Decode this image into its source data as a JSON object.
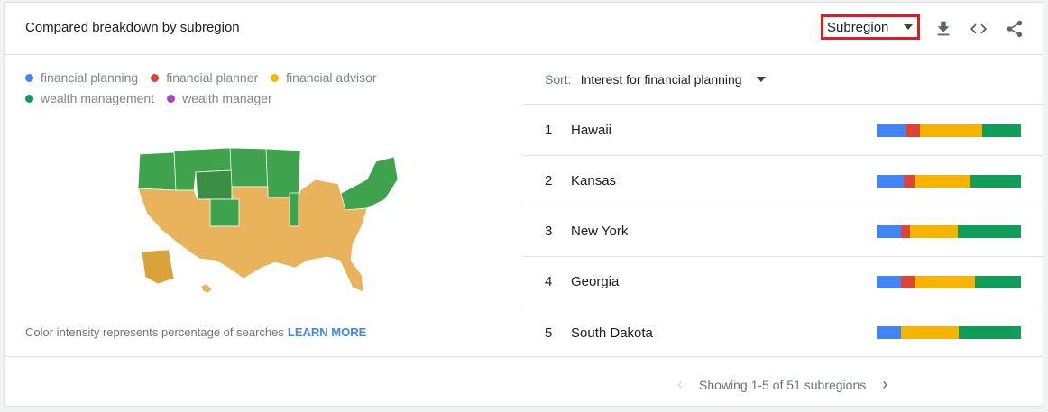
{
  "header": {
    "title": "Compared breakdown by subregion",
    "dropdown_value": "Subregion",
    "icons": [
      "download-icon",
      "embed-code-icon",
      "share-icon"
    ]
  },
  "legend": [
    {
      "label": "financial planning",
      "color": "#4285f4"
    },
    {
      "label": "financial planner",
      "color": "#db4437"
    },
    {
      "label": "financial advisor",
      "color": "#f4b400"
    },
    {
      "label": "wealth management",
      "color": "#0f9d58"
    },
    {
      "label": "wealth manager",
      "color": "#ab47bc"
    }
  ],
  "map": {
    "colors": {
      "green_region": "#3fa34d",
      "yellow_region": "#e8b35a",
      "alaska": "#d9a23a"
    }
  },
  "note": {
    "text": "Color intensity represents percentage of searches",
    "link": "LEARN MORE"
  },
  "sort": {
    "label": "Sort:",
    "value": "Interest for financial planning"
  },
  "rows": [
    {
      "rank": "1",
      "name": "Hawaii",
      "shares": [
        20,
        10,
        43,
        27
      ]
    },
    {
      "rank": "2",
      "name": "Kansas",
      "shares": [
        19,
        7,
        39,
        35
      ]
    },
    {
      "rank": "3",
      "name": "New York",
      "shares": [
        17,
        6,
        33,
        44
      ]
    },
    {
      "rank": "4",
      "name": "Georgia",
      "shares": [
        17,
        9,
        42,
        32
      ]
    },
    {
      "rank": "5",
      "name": "South Dakota",
      "shares": [
        17,
        0,
        40,
        43
      ]
    }
  ],
  "pagination": {
    "text": "Showing 1-5 of 51 subregions",
    "prev_icon": "chevron-left-icon",
    "next_icon": "chevron-right-icon"
  }
}
